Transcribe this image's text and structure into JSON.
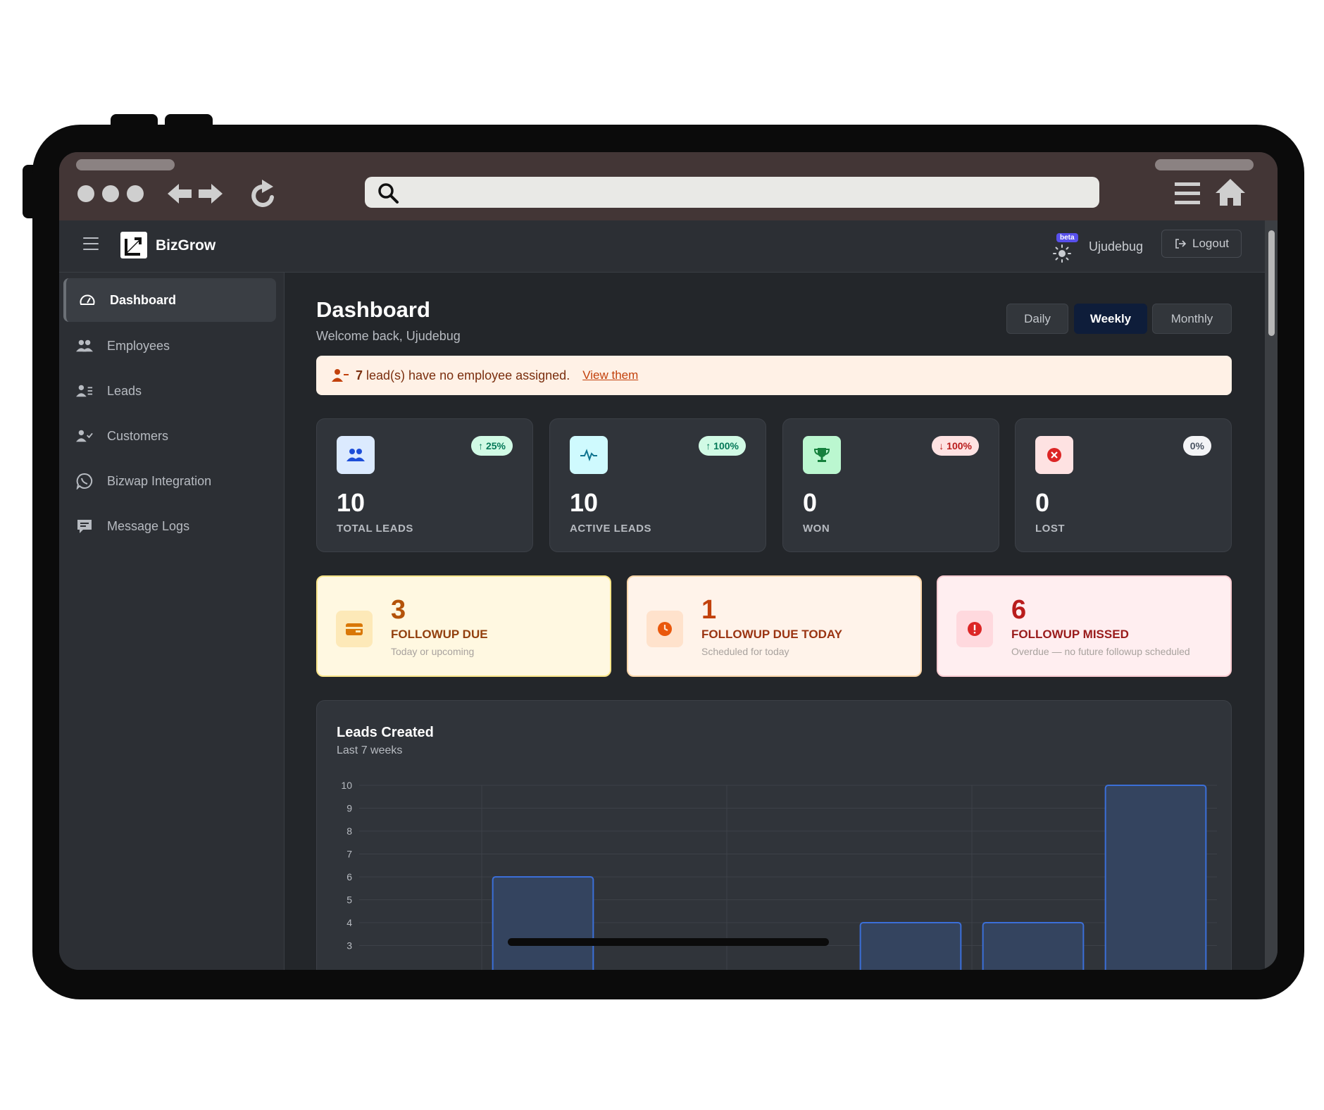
{
  "app": {
    "brand": "BizGrow"
  },
  "header": {
    "beta_label": "beta",
    "username": "Ujudebug",
    "logout_label": "Logout"
  },
  "sidebar": {
    "items": [
      {
        "label": "Dashboard",
        "icon": "speedometer-icon",
        "active": true
      },
      {
        "label": "Employees",
        "icon": "users-icon"
      },
      {
        "label": "Leads",
        "icon": "user-list-icon"
      },
      {
        "label": "Customers",
        "icon": "user-check-icon"
      },
      {
        "label": "Bizwap Integration",
        "icon": "whatsapp-icon"
      },
      {
        "label": "Message Logs",
        "icon": "chat-icon"
      }
    ]
  },
  "dashboard": {
    "title": "Dashboard",
    "subtitle": "Welcome back, Ujudebug",
    "periods": [
      "Daily",
      "Weekly",
      "Monthly"
    ],
    "selected_period": "Weekly"
  },
  "alert": {
    "count": "7",
    "text": "lead(s) have no employee assigned.",
    "link": "View them"
  },
  "stats": [
    {
      "value": "10",
      "label": "TOTAL LEADS",
      "badge": "↑ 25%",
      "icon": "users-icon"
    },
    {
      "value": "10",
      "label": "ACTIVE LEADS",
      "badge": "↑ 100%",
      "icon": "pulse-icon"
    },
    {
      "value": "0",
      "label": "WON",
      "badge": "↓ 100%",
      "icon": "trophy-icon"
    },
    {
      "value": "0",
      "label": "LOST",
      "badge": "0%",
      "icon": "x-circle-icon"
    }
  ],
  "followups": [
    {
      "value": "3",
      "label": "FOLLOWUP DUE",
      "sub": "Today or upcoming",
      "icon": "wallet-icon"
    },
    {
      "value": "1",
      "label": "FOLLOWUP DUE TODAY",
      "sub": "Scheduled for today",
      "icon": "clock-icon"
    },
    {
      "value": "6",
      "label": "FOLLOWUP MISSED",
      "sub": "Overdue — no future followup scheduled",
      "icon": "alert-icon"
    }
  ],
  "chart": {
    "title": "Leads Created",
    "subtitle": "Last 7 weeks"
  },
  "chart_data": {
    "type": "bar",
    "title": "Leads Created",
    "subtitle": "Last 7 weeks",
    "categories": [
      "",
      "",
      "",
      "",
      "",
      "",
      ""
    ],
    "values": [
      0,
      6,
      0,
      0,
      4,
      4,
      10
    ],
    "ylim": [
      0,
      10
    ],
    "yticks": [
      3,
      4,
      5,
      6,
      7,
      8,
      9,
      10
    ],
    "grid": true,
    "bar_color": "#34445f",
    "bar_border": "#3b6fd8"
  },
  "colors": {
    "accent_dark_blue": "#0e1d3a",
    "alert_bg": "#fff1e6",
    "badge_up_bg": "#d1fae5",
    "badge_down_bg": "#fee2e2"
  }
}
